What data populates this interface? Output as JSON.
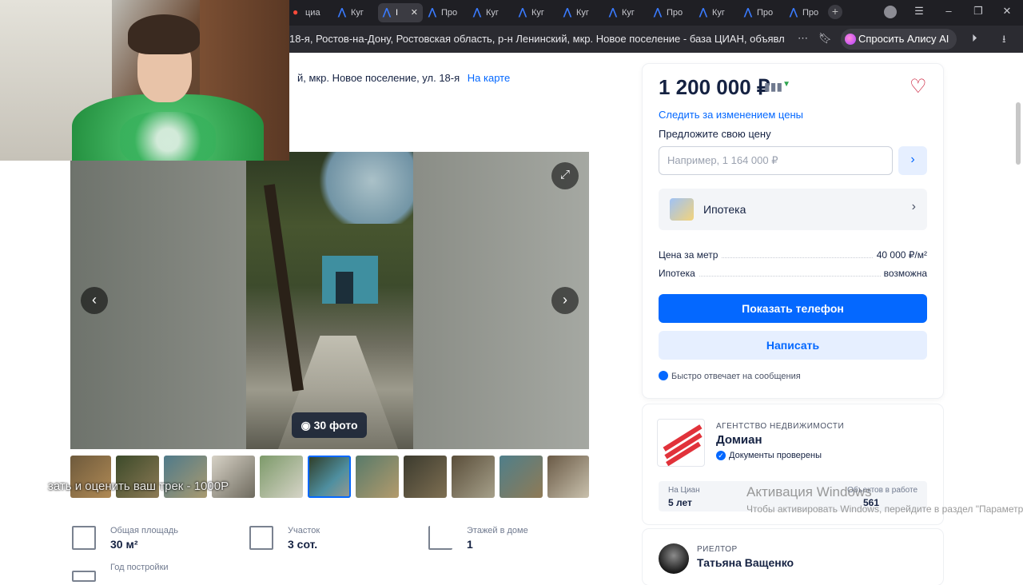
{
  "browser": {
    "tabs": [
      {
        "label": "циа",
        "active": false
      },
      {
        "label": "Куг",
        "active": false
      },
      {
        "label": "I",
        "active": true
      },
      {
        "label": "Про",
        "active": false
      },
      {
        "label": "Куг",
        "active": false
      },
      {
        "label": "Куг",
        "active": false
      },
      {
        "label": "Куг",
        "active": false
      },
      {
        "label": "Куг",
        "active": false
      },
      {
        "label": "Про",
        "active": false
      },
      {
        "label": "Куг",
        "active": false
      },
      {
        "label": "Про",
        "active": false
      },
      {
        "label": "Про",
        "active": false
      }
    ],
    "new_tab_symbol": "+",
    "address": "18-я, Ростов-на-Дону, Ростовская область, р-н Ленинский, мкр. Новое поселение - база ЦИАН, объявл...",
    "alice_label": "Спросить Алису AI"
  },
  "listing": {
    "address_line": "й, мкр. Новое поселение, ул. 18-я",
    "map_link": "На карте",
    "photo_count": "30 фото",
    "overlay_caption": "зать и оценить ваш трек - 1000Р",
    "features": [
      {
        "label": "Общая площадь",
        "value": "30 м²",
        "icon": "area-icon"
      },
      {
        "label": "Участок",
        "value": "3 сот.",
        "icon": "land-plot-icon"
      },
      {
        "label": "Этажей в доме",
        "value": "1",
        "icon": "floors-icon"
      }
    ],
    "build_year_label": "Год постройки"
  },
  "price_panel": {
    "price": "1 200 000 ₽",
    "follow_price": "Следить за изменением цены",
    "offer_label": "Предложите свою цену",
    "offer_placeholder": "Например, 1 164 000 ₽",
    "mortgage_label": "Ипотека",
    "price_per_meter_label": "Цена за метр",
    "price_per_meter_value": "40 000 ₽/м²",
    "mortgage_row_label": "Ипотека",
    "mortgage_row_value": "возможна",
    "show_phone": "Показать телефон",
    "write": "Написать",
    "fast_reply": "Быстро отвечает на сообщения"
  },
  "agency": {
    "kind": "АГЕНТСТВО НЕДВИЖИМОСТИ",
    "name": "Домиан",
    "verified": "Документы проверены",
    "on_cian_label": "На Циан",
    "on_cian_value": "5 лет",
    "objects_label": "Объектов в работе",
    "objects_value": "561"
  },
  "realtor": {
    "kind": "РИЕЛТОР",
    "name": "Татьяна Ващенко"
  },
  "os_watermark": {
    "title": "Активация Windows",
    "subtitle": "Чтобы активировать Windows, перейдите в раздел \"Параметры\"."
  },
  "colors": {
    "accent": "#0468ff",
    "favorite": "#c8102e",
    "text": "#152242"
  }
}
